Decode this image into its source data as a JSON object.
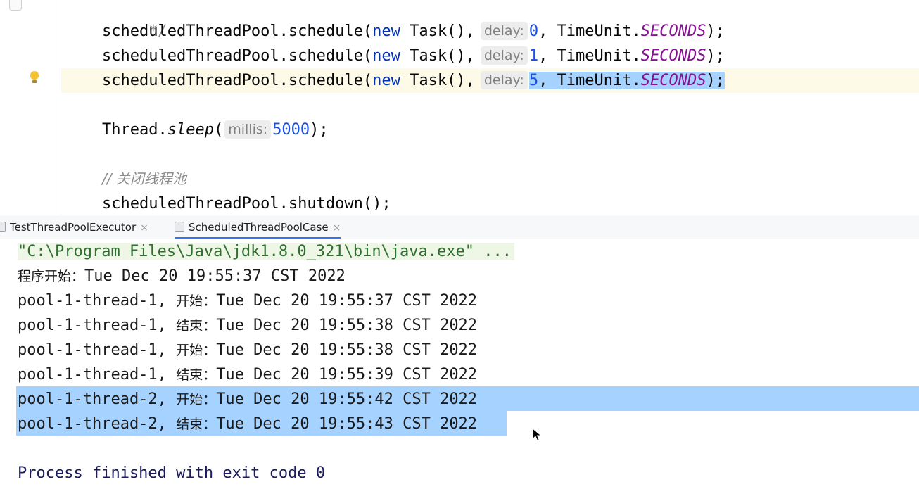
{
  "editor": {
    "lines": [
      {
        "text": " */"
      },
      {
        "receiver": "scheduledThreadPool",
        "method": "schedule",
        "kw": "new",
        "cls": "Task",
        "hint": "delay:",
        "delay": "0",
        "unit_cls": "TimeUnit",
        "unit_const": "SECONDS"
      },
      {
        "receiver": "scheduledThreadPool",
        "method": "schedule",
        "kw": "new",
        "cls": "Task",
        "hint": "delay:",
        "delay": "1",
        "unit_cls": "TimeUnit",
        "unit_const": "SECONDS"
      },
      {
        "receiver": "scheduledThreadPool",
        "method": "schedule",
        "kw": "new",
        "cls": "Task",
        "hint": "delay:",
        "delay": "5",
        "unit_cls": "TimeUnit",
        "unit_const": "SECONDS"
      },
      {
        "receiver": "Thread",
        "method": "sleep",
        "hint": "millis:",
        "value": "5000"
      },
      {
        "text": "// 关闭线程池"
      },
      {
        "receiver": "scheduledThreadPool",
        "method": "shutdown"
      }
    ]
  },
  "tabs": [
    {
      "label": "TestThreadPoolExecutor",
      "close": "×",
      "active": false
    },
    {
      "label": "ScheduledThreadPoolCase",
      "close": "×",
      "active": true
    }
  ],
  "console": {
    "command": "\"C:\\Program Files\\Java\\jdk1.8.0_321\\bin\\java.exe\" ...",
    "start_label": "程序开始：",
    "start_time": "Tue Dec 20 19:55:37 CST 2022",
    "rows": [
      {
        "thread": "pool-1-thread-1, ",
        "event": "开始：",
        "time": "Tue Dec 20 19:55:37 CST 2022"
      },
      {
        "thread": "pool-1-thread-1, ",
        "event": "结束：",
        "time": "Tue Dec 20 19:55:38 CST 2022"
      },
      {
        "thread": "pool-1-thread-1, ",
        "event": "开始：",
        "time": "Tue Dec 20 19:55:38 CST 2022"
      },
      {
        "thread": "pool-1-thread-1, ",
        "event": "结束：",
        "time": "Tue Dec 20 19:55:39 CST 2022"
      },
      {
        "thread": "pool-1-thread-2, ",
        "event": "开始：",
        "time": "Tue Dec 20 19:55:42 CST 2022"
      },
      {
        "thread": "pool-1-thread-2, ",
        "event": "结束：",
        "time": "Tue Dec 20 19:55:43 CST 2022"
      }
    ],
    "exit_message": "Process finished with exit code 0"
  }
}
